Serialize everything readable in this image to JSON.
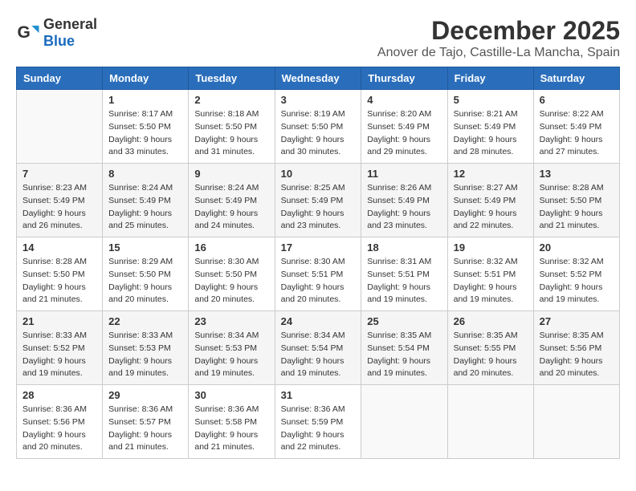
{
  "header": {
    "logo_general": "General",
    "logo_blue": "Blue",
    "month": "December 2025",
    "location": "Anover de Tajo, Castille-La Mancha, Spain"
  },
  "columns": [
    "Sunday",
    "Monday",
    "Tuesday",
    "Wednesday",
    "Thursday",
    "Friday",
    "Saturday"
  ],
  "weeks": [
    [
      {
        "day": "",
        "sunrise": "",
        "sunset": "",
        "daylight": ""
      },
      {
        "day": "1",
        "sunrise": "Sunrise: 8:17 AM",
        "sunset": "Sunset: 5:50 PM",
        "daylight": "Daylight: 9 hours and 33 minutes."
      },
      {
        "day": "2",
        "sunrise": "Sunrise: 8:18 AM",
        "sunset": "Sunset: 5:50 PM",
        "daylight": "Daylight: 9 hours and 31 minutes."
      },
      {
        "day": "3",
        "sunrise": "Sunrise: 8:19 AM",
        "sunset": "Sunset: 5:50 PM",
        "daylight": "Daylight: 9 hours and 30 minutes."
      },
      {
        "day": "4",
        "sunrise": "Sunrise: 8:20 AM",
        "sunset": "Sunset: 5:49 PM",
        "daylight": "Daylight: 9 hours and 29 minutes."
      },
      {
        "day": "5",
        "sunrise": "Sunrise: 8:21 AM",
        "sunset": "Sunset: 5:49 PM",
        "daylight": "Daylight: 9 hours and 28 minutes."
      },
      {
        "day": "6",
        "sunrise": "Sunrise: 8:22 AM",
        "sunset": "Sunset: 5:49 PM",
        "daylight": "Daylight: 9 hours and 27 minutes."
      }
    ],
    [
      {
        "day": "7",
        "sunrise": "Sunrise: 8:23 AM",
        "sunset": "Sunset: 5:49 PM",
        "daylight": "Daylight: 9 hours and 26 minutes."
      },
      {
        "day": "8",
        "sunrise": "Sunrise: 8:24 AM",
        "sunset": "Sunset: 5:49 PM",
        "daylight": "Daylight: 9 hours and 25 minutes."
      },
      {
        "day": "9",
        "sunrise": "Sunrise: 8:24 AM",
        "sunset": "Sunset: 5:49 PM",
        "daylight": "Daylight: 9 hours and 24 minutes."
      },
      {
        "day": "10",
        "sunrise": "Sunrise: 8:25 AM",
        "sunset": "Sunset: 5:49 PM",
        "daylight": "Daylight: 9 hours and 23 minutes."
      },
      {
        "day": "11",
        "sunrise": "Sunrise: 8:26 AM",
        "sunset": "Sunset: 5:49 PM",
        "daylight": "Daylight: 9 hours and 23 minutes."
      },
      {
        "day": "12",
        "sunrise": "Sunrise: 8:27 AM",
        "sunset": "Sunset: 5:49 PM",
        "daylight": "Daylight: 9 hours and 22 minutes."
      },
      {
        "day": "13",
        "sunrise": "Sunrise: 8:28 AM",
        "sunset": "Sunset: 5:50 PM",
        "daylight": "Daylight: 9 hours and 21 minutes."
      }
    ],
    [
      {
        "day": "14",
        "sunrise": "Sunrise: 8:28 AM",
        "sunset": "Sunset: 5:50 PM",
        "daylight": "Daylight: 9 hours and 21 minutes."
      },
      {
        "day": "15",
        "sunrise": "Sunrise: 8:29 AM",
        "sunset": "Sunset: 5:50 PM",
        "daylight": "Daylight: 9 hours and 20 minutes."
      },
      {
        "day": "16",
        "sunrise": "Sunrise: 8:30 AM",
        "sunset": "Sunset: 5:50 PM",
        "daylight": "Daylight: 9 hours and 20 minutes."
      },
      {
        "day": "17",
        "sunrise": "Sunrise: 8:30 AM",
        "sunset": "Sunset: 5:51 PM",
        "daylight": "Daylight: 9 hours and 20 minutes."
      },
      {
        "day": "18",
        "sunrise": "Sunrise: 8:31 AM",
        "sunset": "Sunset: 5:51 PM",
        "daylight": "Daylight: 9 hours and 19 minutes."
      },
      {
        "day": "19",
        "sunrise": "Sunrise: 8:32 AM",
        "sunset": "Sunset: 5:51 PM",
        "daylight": "Daylight: 9 hours and 19 minutes."
      },
      {
        "day": "20",
        "sunrise": "Sunrise: 8:32 AM",
        "sunset": "Sunset: 5:52 PM",
        "daylight": "Daylight: 9 hours and 19 minutes."
      }
    ],
    [
      {
        "day": "21",
        "sunrise": "Sunrise: 8:33 AM",
        "sunset": "Sunset: 5:52 PM",
        "daylight": "Daylight: 9 hours and 19 minutes."
      },
      {
        "day": "22",
        "sunrise": "Sunrise: 8:33 AM",
        "sunset": "Sunset: 5:53 PM",
        "daylight": "Daylight: 9 hours and 19 minutes."
      },
      {
        "day": "23",
        "sunrise": "Sunrise: 8:34 AM",
        "sunset": "Sunset: 5:53 PM",
        "daylight": "Daylight: 9 hours and 19 minutes."
      },
      {
        "day": "24",
        "sunrise": "Sunrise: 8:34 AM",
        "sunset": "Sunset: 5:54 PM",
        "daylight": "Daylight: 9 hours and 19 minutes."
      },
      {
        "day": "25",
        "sunrise": "Sunrise: 8:35 AM",
        "sunset": "Sunset: 5:54 PM",
        "daylight": "Daylight: 9 hours and 19 minutes."
      },
      {
        "day": "26",
        "sunrise": "Sunrise: 8:35 AM",
        "sunset": "Sunset: 5:55 PM",
        "daylight": "Daylight: 9 hours and 20 minutes."
      },
      {
        "day": "27",
        "sunrise": "Sunrise: 8:35 AM",
        "sunset": "Sunset: 5:56 PM",
        "daylight": "Daylight: 9 hours and 20 minutes."
      }
    ],
    [
      {
        "day": "28",
        "sunrise": "Sunrise: 8:36 AM",
        "sunset": "Sunset: 5:56 PM",
        "daylight": "Daylight: 9 hours and 20 minutes."
      },
      {
        "day": "29",
        "sunrise": "Sunrise: 8:36 AM",
        "sunset": "Sunset: 5:57 PM",
        "daylight": "Daylight: 9 hours and 21 minutes."
      },
      {
        "day": "30",
        "sunrise": "Sunrise: 8:36 AM",
        "sunset": "Sunset: 5:58 PM",
        "daylight": "Daylight: 9 hours and 21 minutes."
      },
      {
        "day": "31",
        "sunrise": "Sunrise: 8:36 AM",
        "sunset": "Sunset: 5:59 PM",
        "daylight": "Daylight: 9 hours and 22 minutes."
      },
      {
        "day": "",
        "sunrise": "",
        "sunset": "",
        "daylight": ""
      },
      {
        "day": "",
        "sunrise": "",
        "sunset": "",
        "daylight": ""
      },
      {
        "day": "",
        "sunrise": "",
        "sunset": "",
        "daylight": ""
      }
    ]
  ]
}
